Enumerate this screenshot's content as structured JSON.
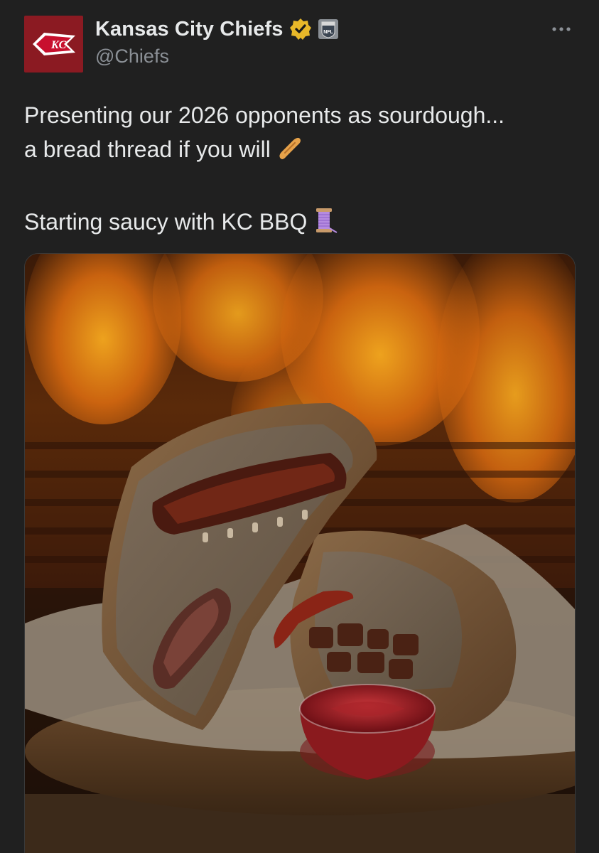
{
  "post": {
    "author": {
      "display_name": "Kansas City Chiefs",
      "handle": "@Chiefs",
      "avatar_text": "KC",
      "verified_icon": "verified-badge-icon",
      "affiliate_icon": "nfl-logo-icon"
    },
    "more_icon": "more-options-icon",
    "text_lines": [
      "Presenting our 2026 opponents as sourdough...",
      "a bread thread if you will",
      "Starting saucy with KC BBQ"
    ],
    "emojis": [
      "baguette-emoji",
      "thread-emoji"
    ],
    "media": {
      "image_name": "bbq-sourdough-photo"
    }
  },
  "colors": {
    "background": "#202020",
    "text": "#e7e9ea",
    "secondary_text": "#8b9096",
    "brand_red": "#8b1a22",
    "verified_gold": "#e8b829"
  }
}
